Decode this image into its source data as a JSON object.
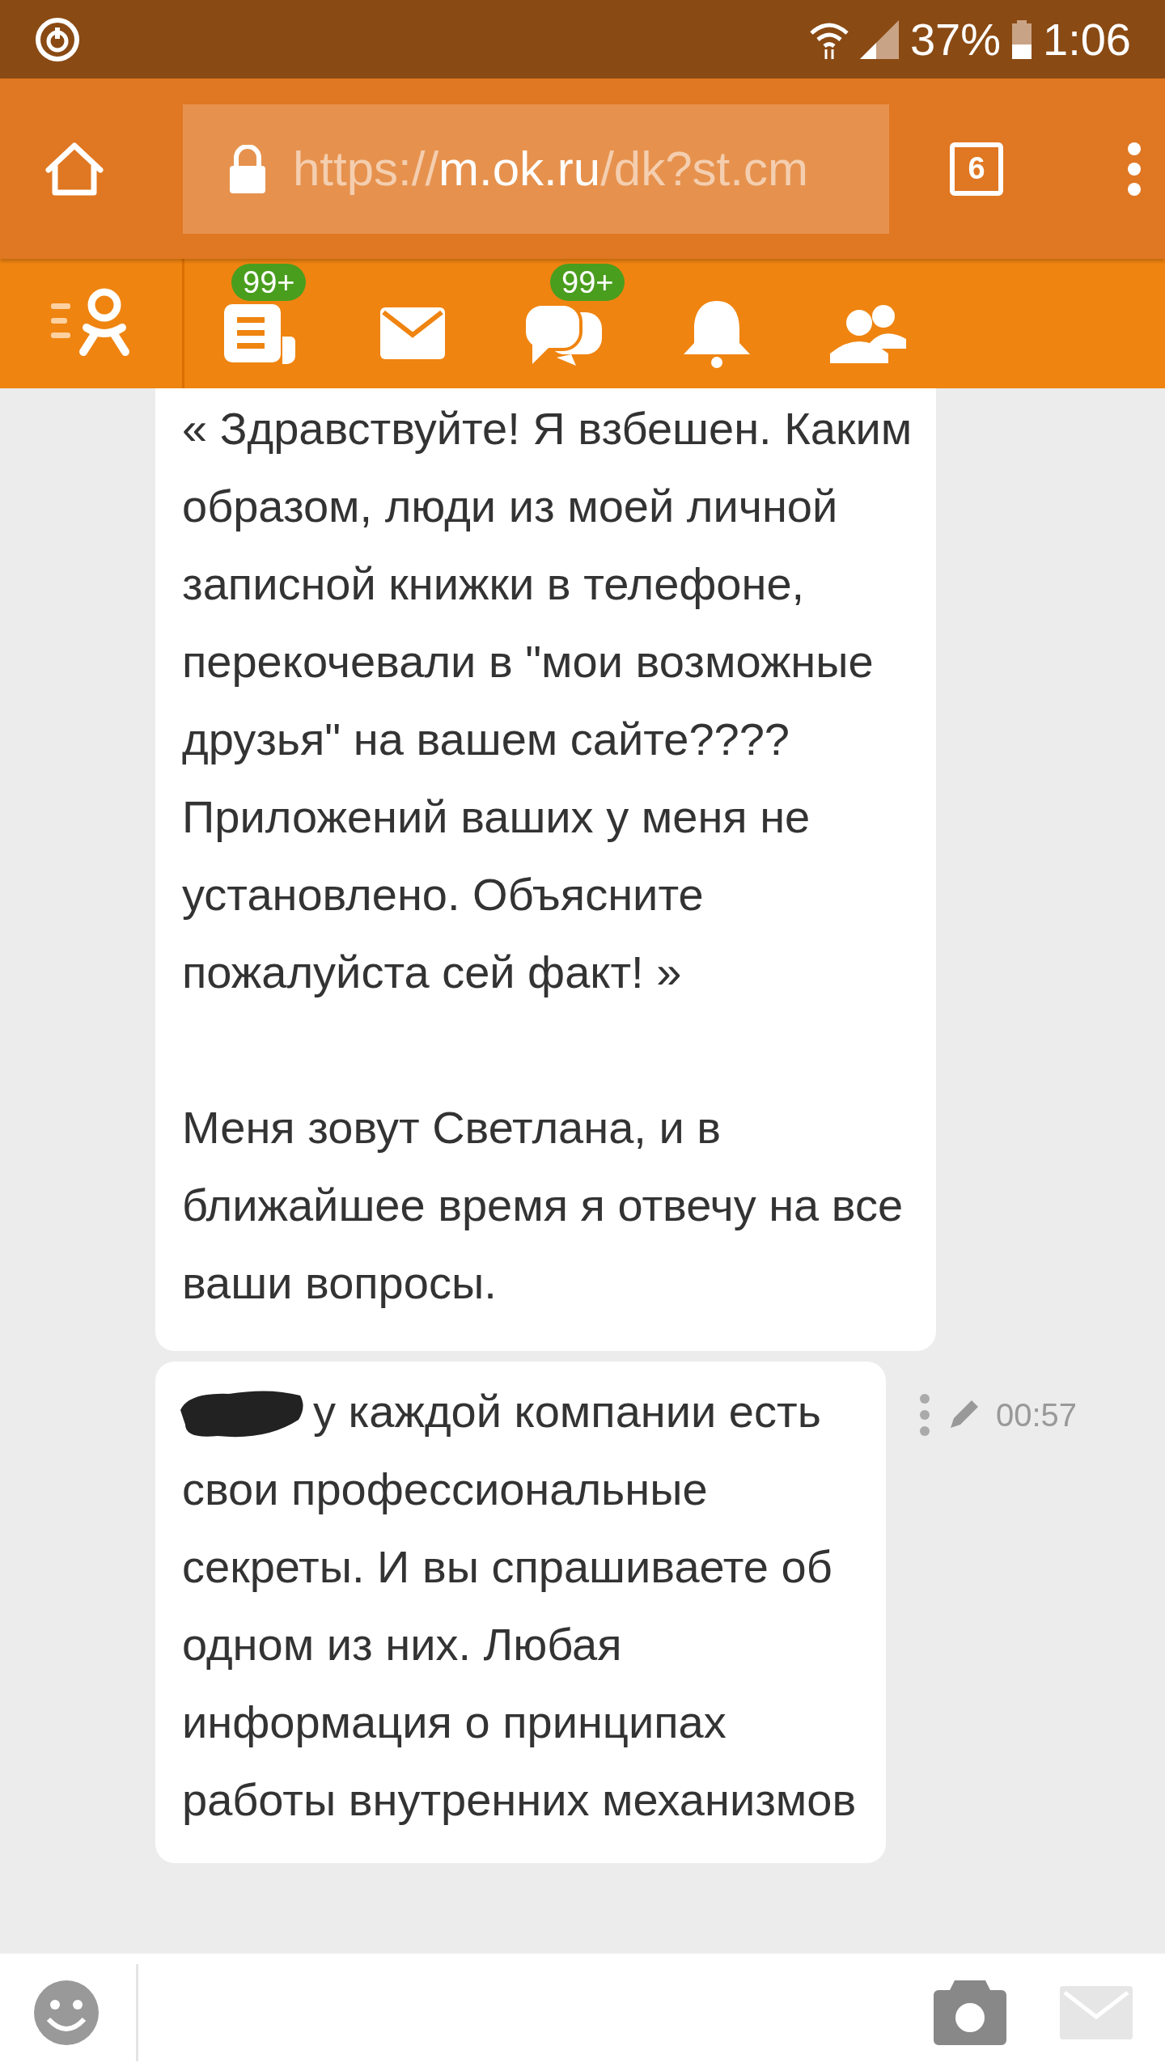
{
  "status_bar": {
    "battery": "37%",
    "time": "1:06"
  },
  "browser": {
    "url": {
      "scheme": "https://",
      "host": "m.ok.ru",
      "path": "/dk?st.cm"
    },
    "tab_count": "6"
  },
  "nav": [
    {
      "kind": "feed",
      "badge": "99+"
    },
    {
      "kind": "mail"
    },
    {
      "kind": "chats",
      "badge": "99+"
    },
    {
      "kind": "notifications"
    },
    {
      "kind": "friends"
    }
  ],
  "messages": [
    {
      "redacted": false,
      "edited": false,
      "paragraphs": [
        "« Здравствуйте! Я взбешен. Каким образом, люди из моей личной записной книжки в телефоне, перекочевали в \"мои возможные друзья\"  на вашем сайте????  Приложений ваших у меня не установлено. Объясните пожалуйста сей факт! »",
        "Меня зовут Светлана, и в ближайшее время я отвечу на все ваши вопросы."
      ]
    },
    {
      "redacted": true,
      "edited": true,
      "time": "00:57",
      "paragraphs": [
        "у каждой компании есть свои профессиональные секреты. И вы спрашиваете об одном из них. Любая информация о принципах работы внутренних механизмов"
      ]
    }
  ],
  "composer": {
    "send_disabled": true
  }
}
